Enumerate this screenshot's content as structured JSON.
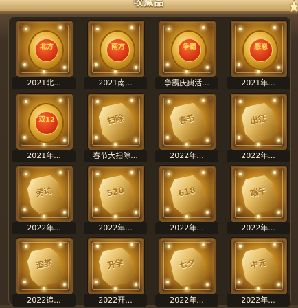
{
  "title": "收藏品",
  "badges": [
    {
      "name": "2021北...",
      "kind": "coin",
      "glyph": "北方"
    },
    {
      "name": "2021南...",
      "kind": "coin",
      "glyph": "南方"
    },
    {
      "name": "争霸庆典活...",
      "kind": "coin",
      "glyph": "争霸"
    },
    {
      "name": "2021年...",
      "kind": "coin",
      "glyph": "感恩"
    },
    {
      "name": "2021年...",
      "kind": "coin",
      "glyph": "双12"
    },
    {
      "name": "春节大扫除...",
      "kind": "plaque",
      "glyph": "扫除"
    },
    {
      "name": "2022年...",
      "kind": "plaque",
      "glyph": "春节"
    },
    {
      "name": "2022年...",
      "kind": "plaque",
      "glyph": "出征"
    },
    {
      "name": "2022年...",
      "kind": "plaque",
      "glyph": "劳动"
    },
    {
      "name": "2022年...",
      "kind": "plaque",
      "glyph": "520"
    },
    {
      "name": "2022年...",
      "kind": "plaque",
      "glyph": "618"
    },
    {
      "name": "2022年...",
      "kind": "plaque",
      "glyph": "端午"
    },
    {
      "name": "2022追...",
      "kind": "plaque",
      "glyph": "追梦"
    },
    {
      "name": "2022开...",
      "kind": "plaque",
      "glyph": "开学"
    },
    {
      "name": "2022年...",
      "kind": "plaque",
      "glyph": "七夕"
    },
    {
      "name": "2022年...",
      "kind": "plaque",
      "glyph": "中元"
    }
  ]
}
